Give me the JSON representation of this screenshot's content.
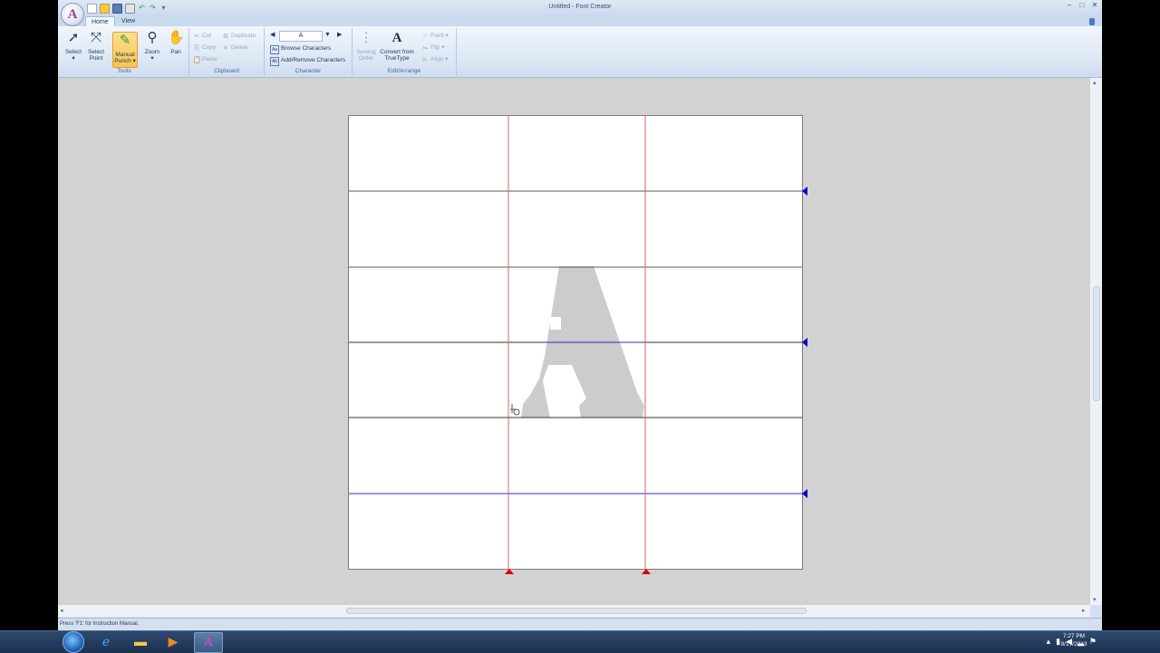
{
  "window": {
    "title": "Untitled - Font Creator",
    "app_logo_letter": "A",
    "controls": [
      "–",
      "□",
      "✕"
    ]
  },
  "tabs": [
    {
      "label": "Home",
      "active": true
    },
    {
      "label": "View",
      "active": false
    }
  ],
  "ribbon": {
    "tools": {
      "label": "Tools",
      "buttons": [
        {
          "line1": "Select",
          "line2": "▾",
          "icon": "arrow-cursor-icon"
        },
        {
          "line1": "Select",
          "line2": "Point",
          "icon": "point-cursor-icon"
        },
        {
          "line1": "Manual",
          "line2": "Punch ▾",
          "icon": "manual-punch-icon",
          "active": true
        },
        {
          "line1": "Zoom",
          "line2": "▾",
          "icon": "zoom-icon"
        },
        {
          "line1": "Pan",
          "line2": "",
          "icon": "hand-icon"
        }
      ]
    },
    "clipboard": {
      "label": "Clipboard",
      "cut": "Cut",
      "copy": "Copy",
      "paste": "Paste",
      "duplicate": "Duplicate",
      "delete": "Delete"
    },
    "character": {
      "label": "Character",
      "current": "A",
      "browse": "Browse Characters",
      "add_remove": "Add/Remove Characters"
    },
    "sewing": {
      "line1": "Sewing",
      "line2": "Order"
    },
    "convert": {
      "line1": "Convert from",
      "line2": "TrueType"
    },
    "edit_arrange": {
      "label": "Edit/Arrange",
      "point": "Point ▾",
      "flip": "Flip ▾",
      "align": "Align ▾"
    }
  },
  "canvas": {
    "glyph": "A",
    "glyph_color": "#cccccc",
    "guide_red": "#e06060",
    "guide_blue": "#0000cc"
  },
  "status": {
    "text": "Press 'F1' for Instruction Manual."
  },
  "taskbar": {
    "time": "7:27 PM",
    "date": "9/17/2013",
    "active_app_letter": "A"
  }
}
